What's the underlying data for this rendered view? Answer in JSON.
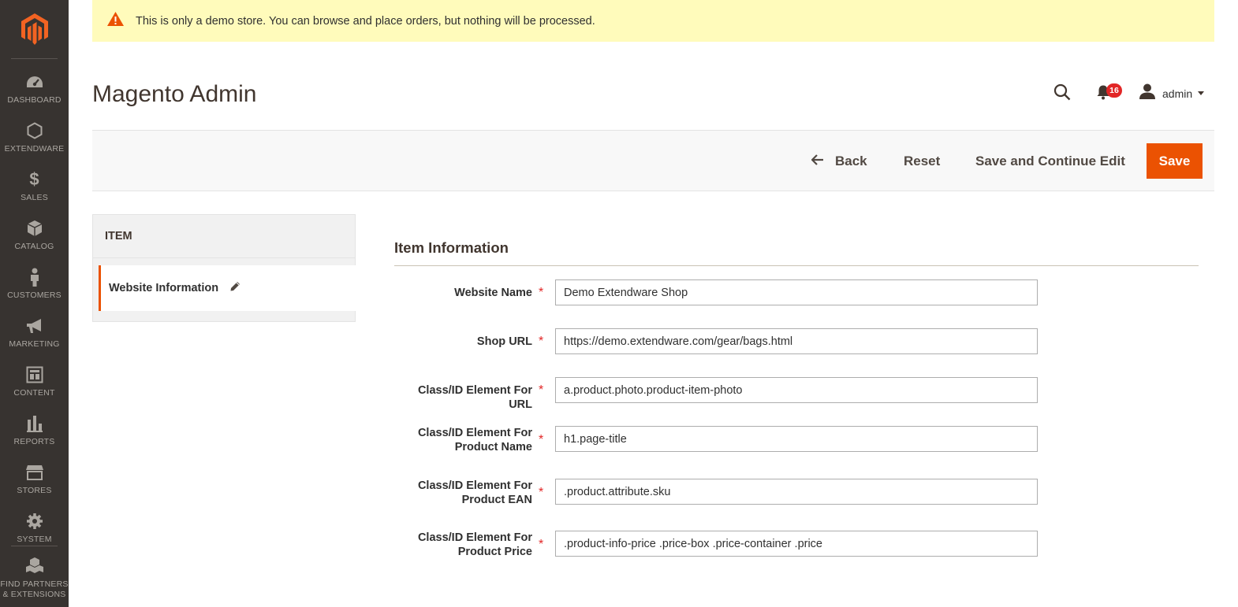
{
  "notice": {
    "text": "This is only a demo store. You can browse and place orders, but nothing will be processed."
  },
  "sidebar": {
    "items": [
      {
        "label": "DASHBOARD",
        "icon": "dashboard-icon"
      },
      {
        "label": "EXTENDWARE",
        "icon": "hexagon-icon"
      },
      {
        "label": "SALES",
        "icon": "dollar-icon"
      },
      {
        "label": "CATALOG",
        "icon": "box-icon"
      },
      {
        "label": "CUSTOMERS",
        "icon": "person-icon"
      },
      {
        "label": "MARKETING",
        "icon": "megaphone-icon"
      },
      {
        "label": "CONTENT",
        "icon": "layout-icon"
      },
      {
        "label": "REPORTS",
        "icon": "bar-chart-icon"
      },
      {
        "label": "STORES",
        "icon": "store-icon"
      },
      {
        "label": "SYSTEM",
        "icon": "gear-icon"
      },
      {
        "label_line1": "FIND PARTNERS",
        "label_line2": "& EXTENSIONS",
        "icon": "cubes-icon"
      }
    ]
  },
  "header": {
    "title": "Magento Admin",
    "notifications_count": "16",
    "user_name": "admin"
  },
  "actions": {
    "back": "Back",
    "reset": "Reset",
    "save_continue": "Save and Continue Edit",
    "save": "Save"
  },
  "tabs": {
    "heading": "ITEM",
    "items": [
      {
        "label": "Website Information"
      }
    ]
  },
  "form": {
    "section_title": "Item Information",
    "fields": [
      {
        "label_line1": "Website Name",
        "label_line2": "",
        "value": "Demo Extendware Shop"
      },
      {
        "label_line1": "Shop URL",
        "label_line2": "",
        "value": "https://demo.extendware.com/gear/bags.html"
      },
      {
        "label_line1": "Class/ID Element For URL",
        "label_line2": "",
        "value": "a.product.photo.product-item-photo"
      },
      {
        "label_line1": "Class/ID Element For",
        "label_line2": "Product Name",
        "value": "h1.page-title"
      },
      {
        "label_line1": "Class/ID Element For",
        "label_line2": "Product EAN",
        "value": ".product.attribute.sku"
      },
      {
        "label_line1": "Class/ID Element For",
        "label_line2": "Product Price",
        "value": ".product-info-price .price-box .price-container .price"
      }
    ],
    "required_mark": "*"
  },
  "colors": {
    "sidebar_bg": "#373330",
    "accent": "#eb5202",
    "notice_bg": "#fffbbb",
    "badge": "#e22626"
  }
}
